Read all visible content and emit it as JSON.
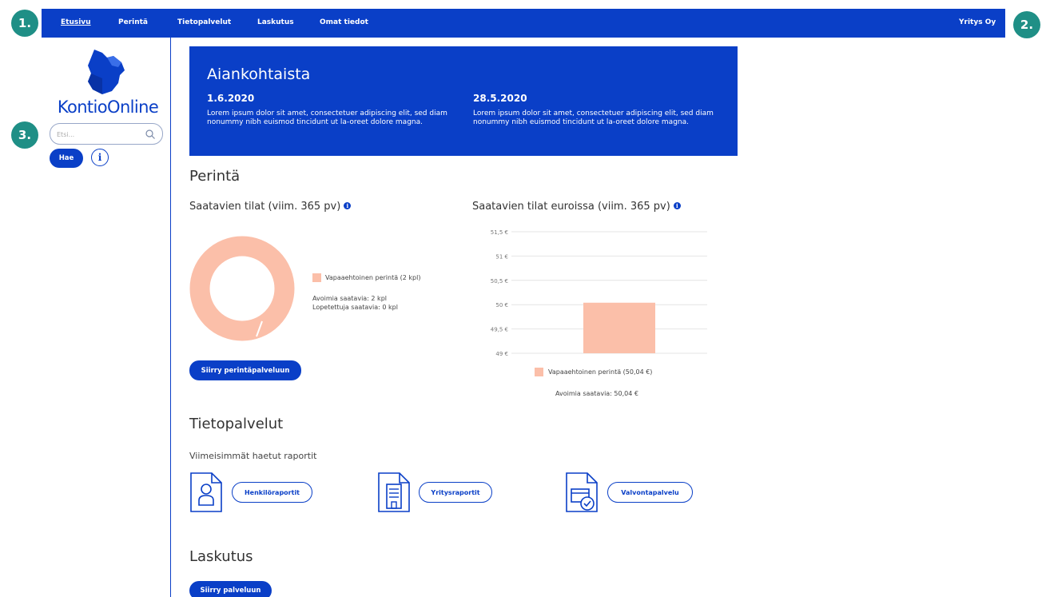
{
  "markers": [
    "1.",
    "2.",
    "3."
  ],
  "nav": {
    "items": [
      "Etusivu",
      "Perintä",
      "Tietopalvelut",
      "Laskutus",
      "Omat tiedot"
    ],
    "company": "Yritys Oy"
  },
  "sidebar": {
    "brand": "KontioOnline",
    "search_placeholder": "Etsi...",
    "search_button": "Hae",
    "info_glyph": "i"
  },
  "news": {
    "title": "Aiankohtaista",
    "items": [
      {
        "date": "1.6.2020",
        "text": "Lorem ipsum dolor sit amet, consectetuer adipiscing elit, sed diam nonummy nibh euismod tincidunt ut la-oreet dolore magna."
      },
      {
        "date": "28.5.2020",
        "text": "Lorem ipsum dolor sit amet, consectetuer adipiscing elit, sed diam nonummy nibh euismod tincidunt ut la-oreet dolore magna."
      }
    ]
  },
  "perinta": {
    "heading": "Perintä",
    "donut_title": "Saatavien tilat (viim. 365 pv)",
    "donut_legend": "Vapaaehtoinen perintä (2 kpl)",
    "open_label": "Avoimia saatavia: 2 kpl",
    "closed_label": "Lopetettuja saatavia: 0 kpl",
    "button": "Siirry perintäpalveluun",
    "bar_title": "Saatavien tilat euroissa (viim. 365 pv)",
    "bar_legend": "Vapaaehtoinen perintä (50,04 €)",
    "bar_total": "Avoimia saatavia: 50,04 €"
  },
  "tietopalvelut": {
    "heading": "Tietopalvelut",
    "subheading": "Viimeisimmät haetut raportit",
    "reports": [
      {
        "label": "Henkilöraportit",
        "icon": "person-document-icon"
      },
      {
        "label": "Yritysraportit",
        "icon": "building-document-icon"
      },
      {
        "label": "Valvontapalvelu",
        "icon": "monitor-document-icon"
      }
    ]
  },
  "laskutus": {
    "heading": "Laskutus",
    "button": "Siirry palveluun"
  },
  "colors": {
    "brand": "#0a3fc7",
    "marker": "#1f8f86",
    "chart": "#fbbfa9"
  },
  "chart_data": [
    {
      "type": "pie",
      "title": "Saatavien tilat (viim. 365 pv)",
      "categories": [
        "Vapaaehtoinen perintä (2 kpl)"
      ],
      "values": [
        2
      ],
      "donut": true
    },
    {
      "type": "bar",
      "title": "Saatavien tilat euroissa (viim. 365 pv)",
      "categories": [
        ""
      ],
      "series": [
        {
          "name": "Vapaaehtoinen perintä (50,04 €)",
          "values": [
            50.04
          ]
        }
      ],
      "ylim": [
        49,
        51.5
      ],
      "yticks": [
        "49 €",
        "49,5 €",
        "50 €",
        "50,5 €",
        "51 €",
        "51,5 €"
      ],
      "grid": true,
      "legend": "bottom"
    }
  ]
}
